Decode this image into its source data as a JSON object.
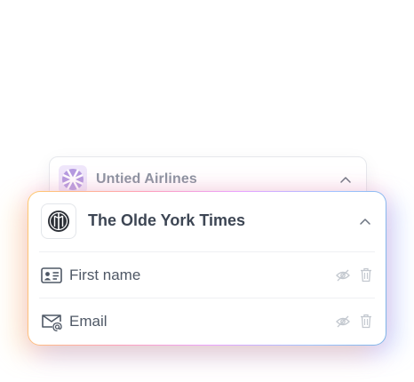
{
  "back_card": {
    "title": "Untied Airlines"
  },
  "front_card": {
    "title": "The Olde York Times",
    "fields": [
      {
        "label": "First name"
      },
      {
        "label": "Email"
      }
    ]
  },
  "icons": {
    "back_logo": "globe-grid-logo-icon",
    "front_logo": "newspaper-logo-icon",
    "chevron": "chevron-up-icon",
    "first_name": "id-card-icon",
    "email": "envelope-at-icon",
    "hide": "eye-slash-icon",
    "delete": "trash-icon"
  },
  "colors": {
    "accent_purple": "#9b7fd1",
    "text": "#4a5563",
    "muted_icon": "#c3c8cf"
  }
}
